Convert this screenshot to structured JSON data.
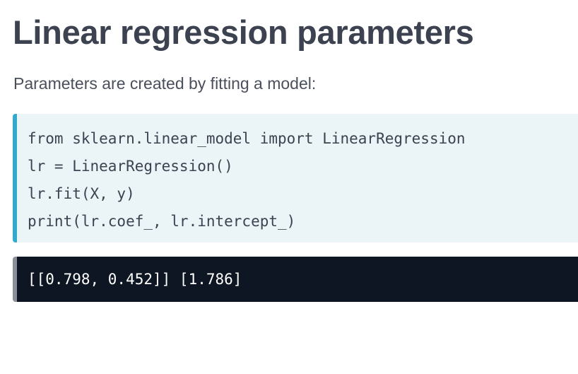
{
  "title": "Linear regression parameters",
  "subtitle": "Parameters are created by fitting a model:",
  "code": {
    "lines": [
      "from sklearn.linear_model import LinearRegression",
      "lr = LinearRegression()",
      "lr.fit(X, y)",
      "print(lr.coef_, lr.intercept_)"
    ],
    "accent_color": "#33aacc",
    "background_color": "#ebf4f7"
  },
  "output": {
    "text": "[[0.798, 0.452]] [1.786]",
    "accent_color": "#8a9099",
    "background_color": "#0d1622"
  }
}
